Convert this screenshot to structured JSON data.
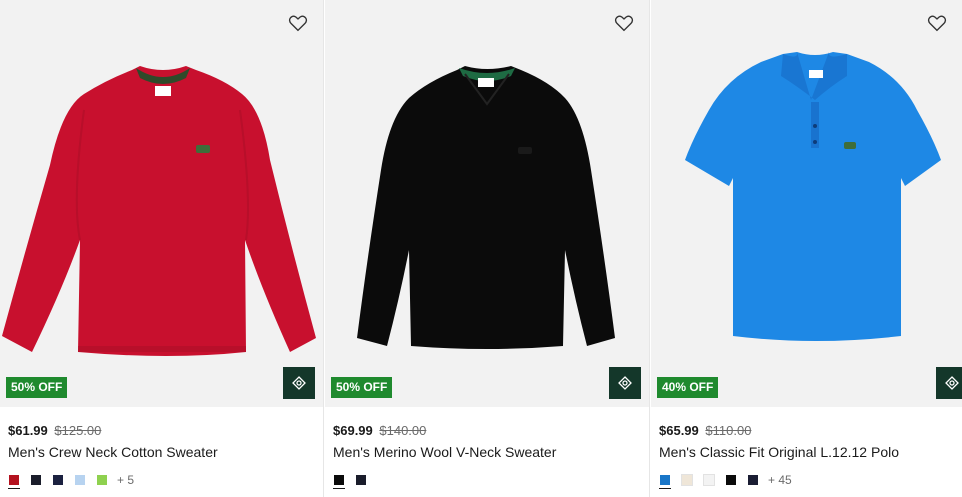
{
  "products": [
    {
      "badge": "50% OFF",
      "price": "$61.99",
      "original_price": "$125.00",
      "title": "Men's Crew Neck Cotton Sweater",
      "garment_color": "#c8102e",
      "collar_color": "#2f4a2a",
      "icon": "crew-neck-sweater-image",
      "swatches": [
        "#b4121f",
        "#1a1d2b",
        "#1b2140",
        "#b7d3f0",
        "#8fd14f"
      ],
      "more_colors": "+ 5"
    },
    {
      "badge": "50% OFF",
      "price": "$69.99",
      "original_price": "$140.00",
      "title": "Men's Merino Wool V-Neck Sweater",
      "garment_color": "#0b0b0b",
      "collar_color": "#1e6b43",
      "icon": "v-neck-sweater-image",
      "swatches": [
        "#0b0b0b",
        "#1a1d2b"
      ],
      "more_colors": ""
    },
    {
      "badge": "40% OFF",
      "price": "$65.99",
      "original_price": "$110.00",
      "title": "Men's Classic Fit Original L.12.12 Polo",
      "garment_color": "#1e88e5",
      "collar_color": "#1e88e5",
      "icon": "polo-shirt-image",
      "swatches": [
        "#1976c8",
        "#efe6d8",
        "#f3f3f3",
        "#0b0b0b",
        "#1a1d33"
      ],
      "more_colors": "+ 45"
    }
  ],
  "colors": {
    "badge_bg": "#1f8a2e",
    "quick_view_bg": "#14372a",
    "media_bg": "#f2f2f2"
  }
}
